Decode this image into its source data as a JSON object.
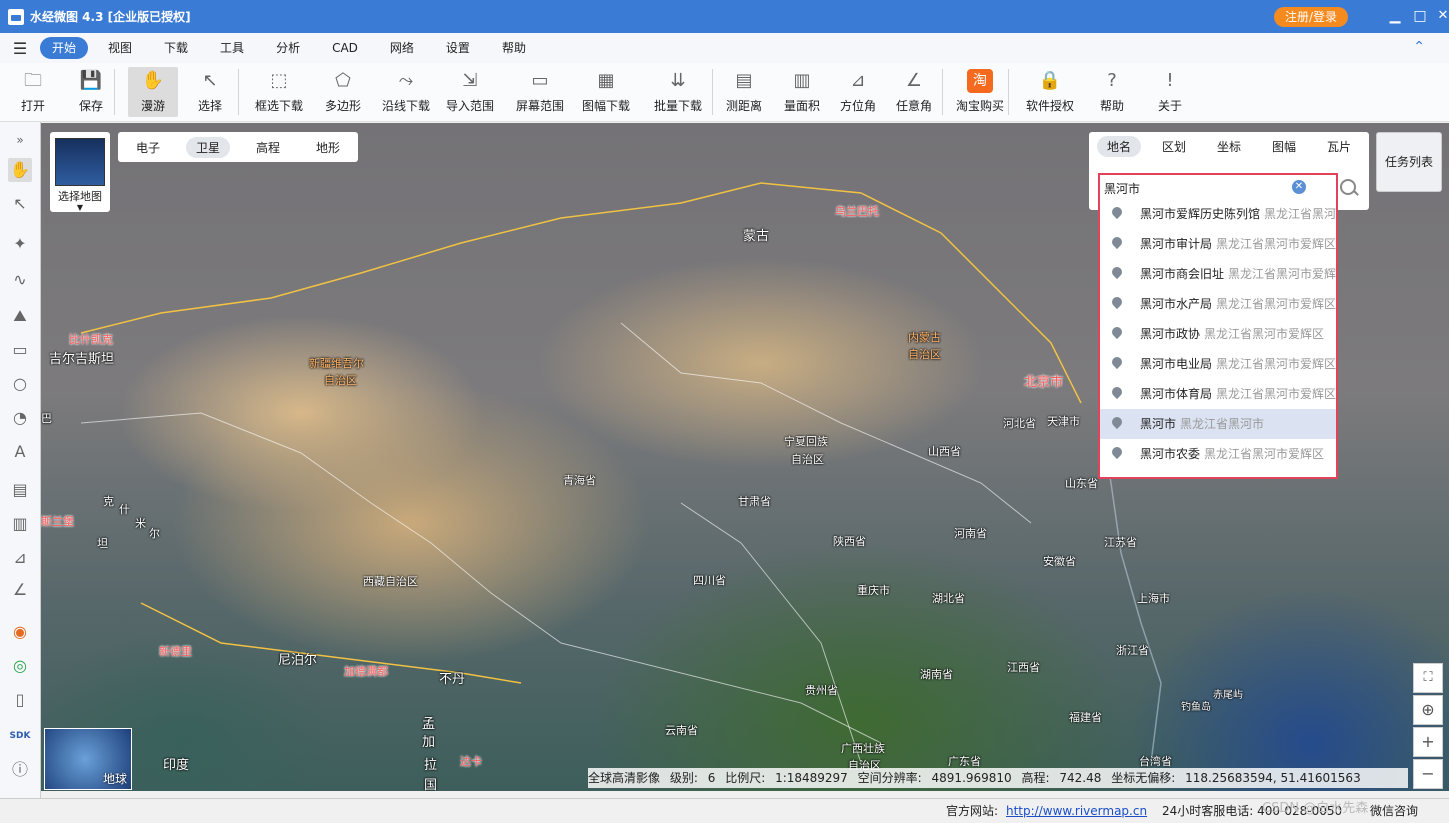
{
  "app": {
    "title": "水经微图 4.3 [企业版已授权]",
    "login_label": "注册/登录",
    "window_controls": [
      "minimize-icon",
      "maximize-icon",
      "close-icon"
    ]
  },
  "menu": {
    "items": [
      "开始",
      "视图",
      "下载",
      "工具",
      "分析",
      "CAD",
      "网络",
      "设置",
      "帮助"
    ],
    "active": "开始"
  },
  "toolbar": {
    "buttons": [
      {
        "label": "打开",
        "icon": "folder-icon"
      },
      {
        "label": "保存",
        "icon": "save-icon"
      },
      {
        "label": "漫游",
        "icon": "hand-icon",
        "selected": true
      },
      {
        "label": "选择",
        "icon": "cursor-icon"
      },
      {
        "label": "框选下载",
        "icon": "rect-download-icon"
      },
      {
        "label": "多边形",
        "icon": "polygon-icon"
      },
      {
        "label": "沿线下载",
        "icon": "polyline-icon"
      },
      {
        "label": "导入范围",
        "icon": "import-icon"
      },
      {
        "label": "屏幕范围",
        "icon": "screen-icon"
      },
      {
        "label": "图幅下载",
        "icon": "grid-download-icon"
      },
      {
        "label": "批量下载",
        "icon": "batch-download-icon"
      },
      {
        "label": "测距离",
        "icon": "ruler-icon"
      },
      {
        "label": "量面积",
        "icon": "area-icon"
      },
      {
        "label": "方位角",
        "icon": "azimuth-icon"
      },
      {
        "label": "任意角",
        "icon": "angle-icon"
      },
      {
        "label": "淘宝购买",
        "icon": "taobao-icon"
      },
      {
        "label": "软件授权",
        "icon": "lock-icon"
      },
      {
        "label": "帮助",
        "icon": "help-icon"
      },
      {
        "label": "关于",
        "icon": "info-icon"
      }
    ]
  },
  "map_tabs": {
    "items": [
      "电子",
      "卫星",
      "高程",
      "地形"
    ],
    "active": "卫星"
  },
  "select_map": {
    "label": "选择地图"
  },
  "search": {
    "tabs": [
      "地名",
      "区划",
      "坐标",
      "图幅",
      "瓦片"
    ],
    "active_tab": "地名",
    "value": "黑河市",
    "results": [
      {
        "name": "黑河市爱辉历史陈列馆",
        "addr": "黑龙江省黑河"
      },
      {
        "name": "黑河市审计局",
        "addr": "黑龙江省黑河市爱辉区"
      },
      {
        "name": "黑河市商会旧址",
        "addr": "黑龙江省黑河市爱辉"
      },
      {
        "name": "黑河市水产局",
        "addr": "黑龙江省黑河市爱辉区"
      },
      {
        "name": "黑河市政协",
        "addr": "黑龙江省黑河市爱辉区"
      },
      {
        "name": "黑河市电业局",
        "addr": "黑龙江省黑河市爱辉区"
      },
      {
        "name": "黑河市体育局",
        "addr": "黑龙江省黑河市爱辉区"
      },
      {
        "name": "黑河市",
        "addr": "黑龙江省黑河市",
        "highlighted": true
      },
      {
        "name": "黑河市农委",
        "addr": "黑龙江省黑河市爱辉区"
      }
    ]
  },
  "task_list": {
    "label": "任务列表"
  },
  "map_labels": {
    "mongolia": "蒙古",
    "ulaanbaatar": "乌兰巴托",
    "bishkek": "比什凯克",
    "kyrgyzstan": "吉尔吉斯坦",
    "xinjiang_1": "新疆维吾尔",
    "xinjiang_2": "自治区",
    "inner_mongolia_1": "内蒙古",
    "inner_mongolia_2": "自治区",
    "beijing": "北京市",
    "tianjin": "天津市",
    "hebei": "河北省",
    "ningxia_1": "宁夏回族",
    "ningxia_2": "自治区",
    "shanxi": "山西省",
    "qinghai": "青海省",
    "gansu": "甘肃省",
    "shandong": "山东省",
    "henan": "河南省",
    "shaanxi": "陕西省",
    "jiangsu": "江苏省",
    "anhui": "安徽省",
    "tibet": "西藏自治区",
    "sichuan": "四川省",
    "chongqing": "重庆市",
    "hubei": "湖北省",
    "shanghai": "上海市",
    "newdelhi": "新德里",
    "nepal": "尼泊尔",
    "kathmandu": "加德满都",
    "bhutan": "不丹",
    "zhejiang": "浙江省",
    "hunan": "湖南省",
    "jiangxi": "江西省",
    "guizhou": "贵州省",
    "taipei": "赤尾屿",
    "diaoyu": "钓鱼岛",
    "fujian": "福建省",
    "bangladesh_1": "孟",
    "bangladesh_2": "加",
    "bangladesh_3": "拉",
    "bangladesh_4": "国",
    "dhaka": "达卡",
    "yunnan": "云南省",
    "guangxi_1": "广西壮族",
    "guangxi_2": "自治区",
    "guangdong": "广东省",
    "taiwan": "台湾省",
    "india": "印度",
    "islamabad": "斯兰堡",
    "ba": "巴",
    "pakistan_1": "克",
    "pakistan_2": "什",
    "pakistan_3": "米",
    "pakistan_4": "尔",
    "hanzi_e": "坦"
  },
  "globe": {
    "label": "地球"
  },
  "status": {
    "source": "全球高清影像",
    "level_label": "级别:",
    "level": "6",
    "scale_label": "比例尺:",
    "scale": "1:18489297",
    "resolution_label": "空间分辨率:",
    "resolution": "4891.969810",
    "elevation_label": "高程:",
    "elevation": "742.48",
    "coord_label": "坐标无偏移:",
    "coord": "118.25683594, 51.41601563"
  },
  "footer": {
    "site_label": "官方网站:",
    "url": "http://www.rivermap.cn",
    "hotline": "24小时客服电话: 400-028-0050",
    "wechat": "微信咨询",
    "watermark": "CSDN @白水先森"
  },
  "colors": {
    "accent": "#3a7bd5",
    "login": "#f58a1f",
    "search_border": "#e0435a"
  }
}
